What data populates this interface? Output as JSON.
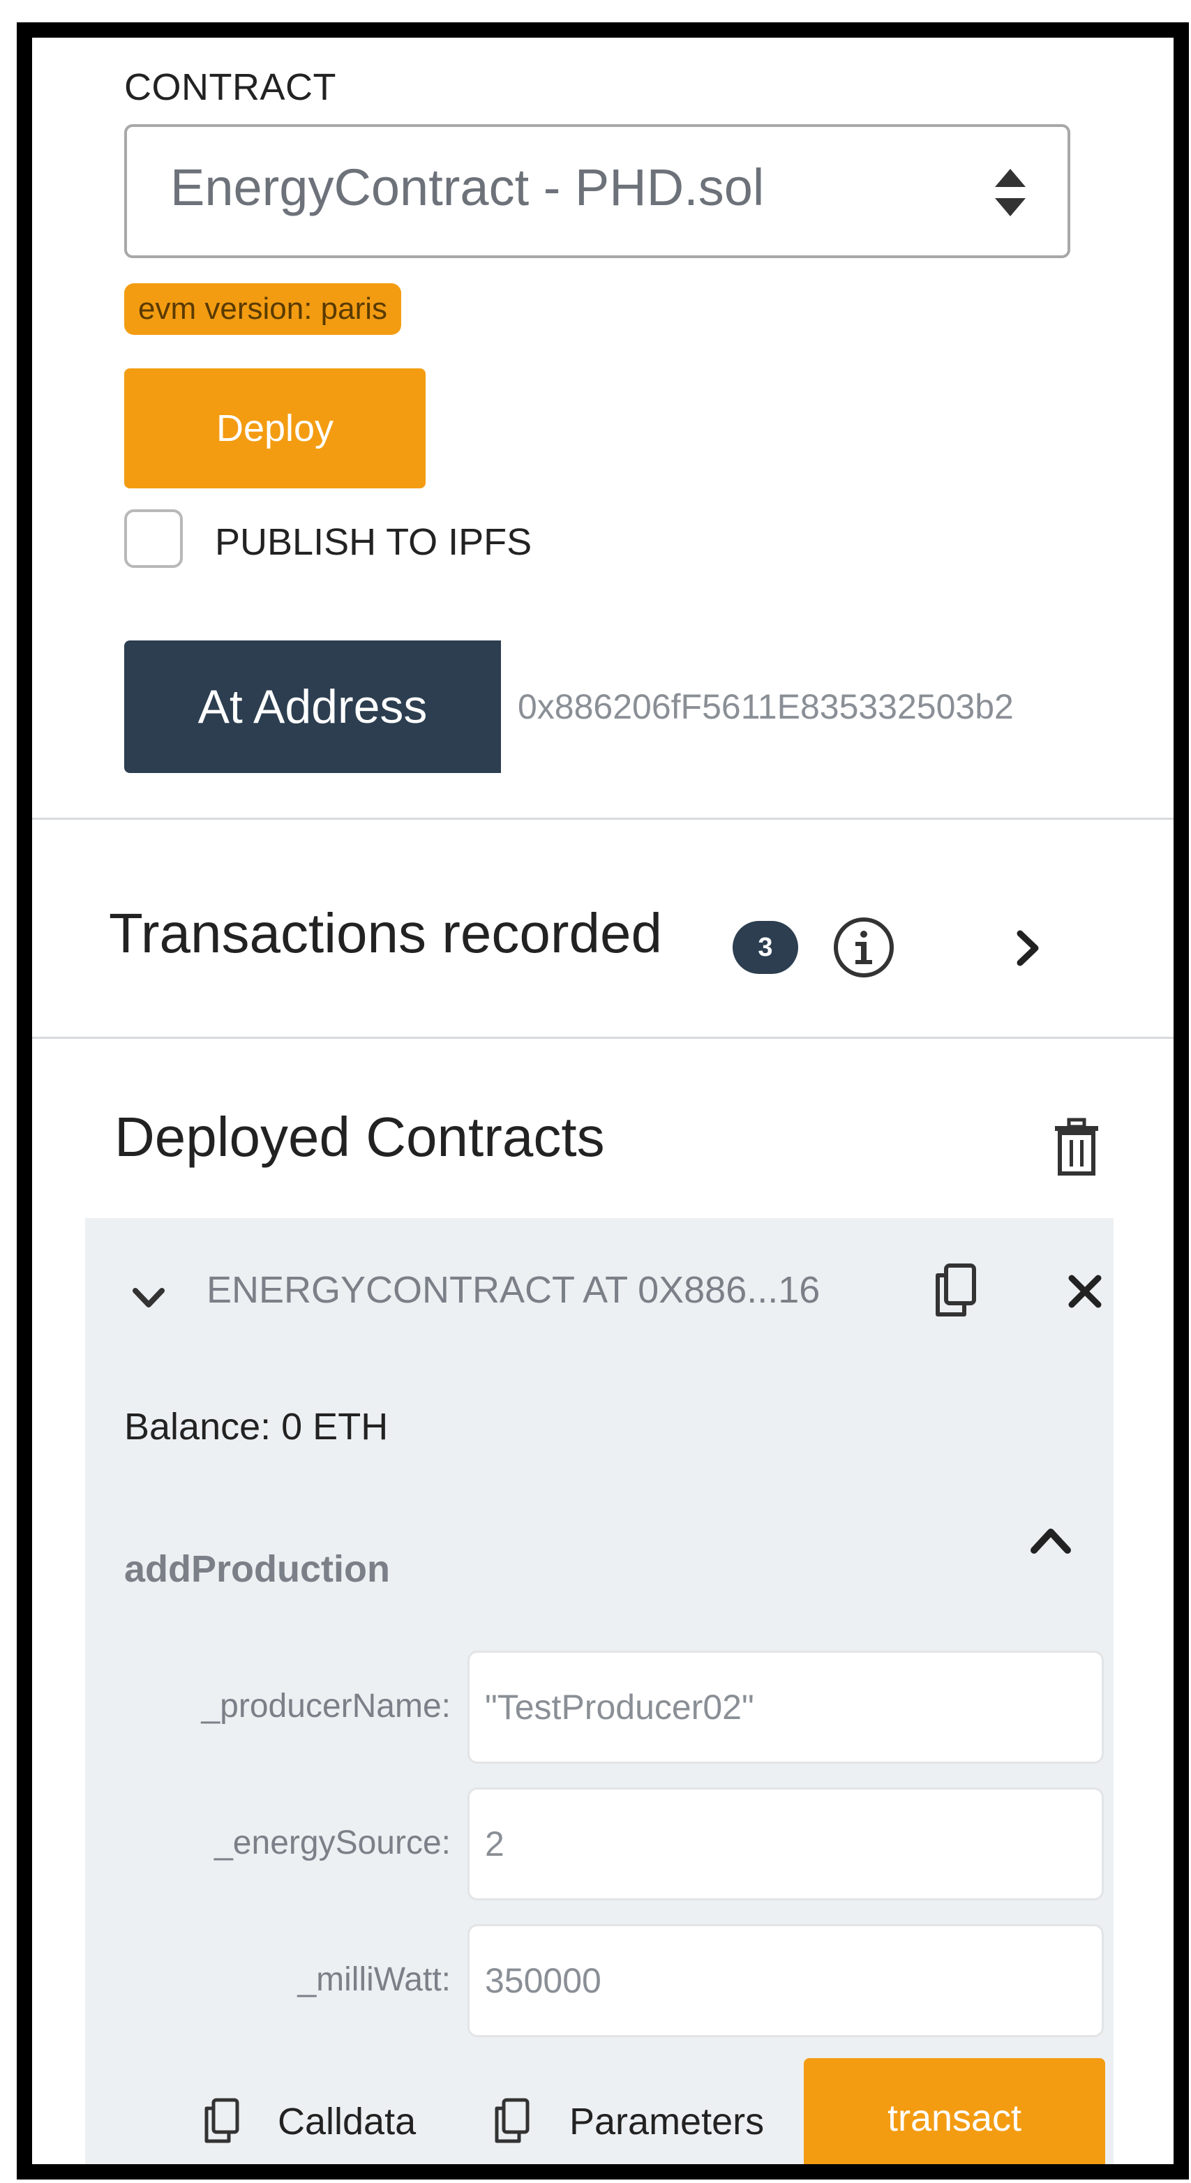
{
  "contract_section": {
    "label": "CONTRACT",
    "selected_contract": "EnergyContract - PHD.sol",
    "evm_badge": "evm version: paris",
    "deploy_label": "Deploy",
    "publish_label": "PUBLISH TO IPFS",
    "publish_checked": false,
    "at_address_label": "At Address",
    "at_address_value": "0x886206fF5611E835332503b2"
  },
  "transactions": {
    "title": "Transactions recorded",
    "count": "3"
  },
  "deployed": {
    "title": "Deployed Contracts",
    "instance": {
      "title": "ENERGYCONTRACT AT 0X886...16",
      "balance": "Balance: 0 ETH",
      "function_name": "addProduction",
      "params": [
        {
          "label": "_producerName:",
          "value": "\"TestProducer02\""
        },
        {
          "label": "_energySource:",
          "value": "2"
        },
        {
          "label": "_milliWatt:",
          "value": "350000"
        }
      ],
      "calldata_label": "Calldata",
      "parameters_label": "Parameters",
      "transact_label": "transact"
    }
  },
  "colors": {
    "accent_orange": "#f39c12",
    "dark_navy": "#2c3e50",
    "panel_gray": "#edf0f2"
  }
}
